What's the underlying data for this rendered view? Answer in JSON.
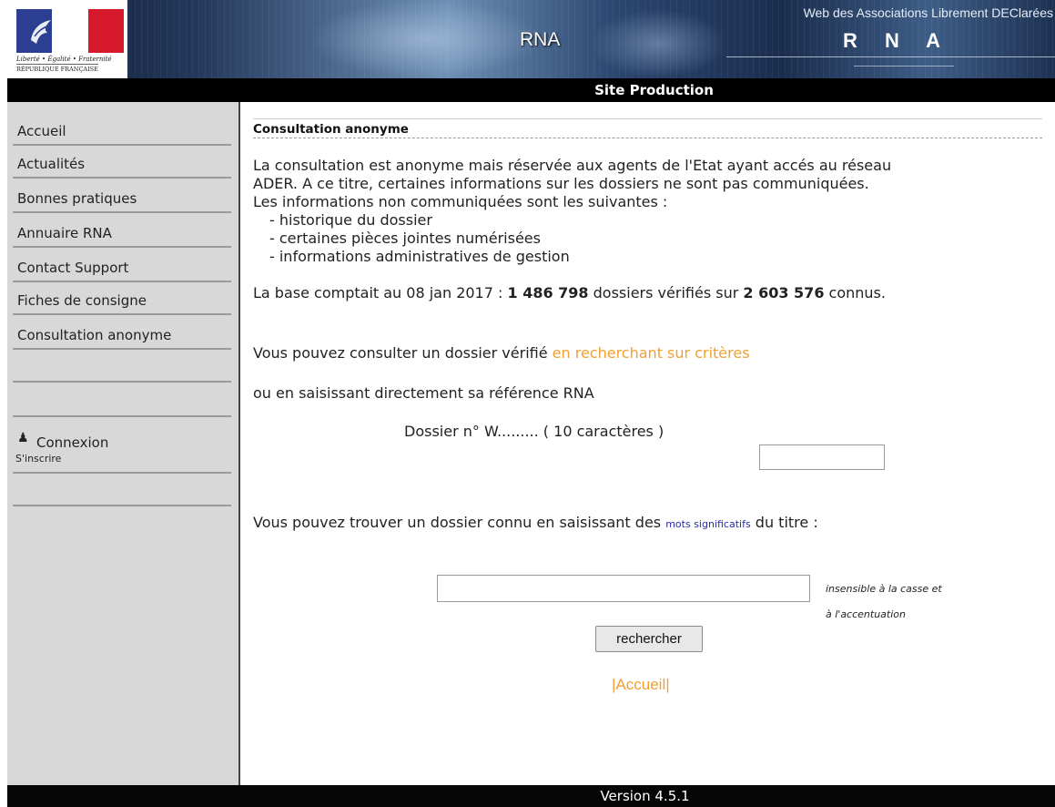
{
  "header": {
    "logo": {
      "devise": "Liberté • Égalité • Fraternité",
      "republique": "RÉPUBLIQUE FRANÇAISE"
    },
    "center_title": "RNA",
    "tagline": "Web des Associations Librement DEClarées",
    "brand": "R N A"
  },
  "site_bar": "Site Production",
  "sidebar": {
    "items": [
      {
        "label": "Accueil"
      },
      {
        "label": "Actualités"
      },
      {
        "label": "Bonnes pratiques"
      },
      {
        "label": "Annuaire RNA"
      },
      {
        "label": "Contact Support"
      },
      {
        "label": "Fiches de consigne"
      },
      {
        "label": "Consultation anonyme"
      }
    ],
    "connexion": "Connexion",
    "inscrire": "S'inscrire"
  },
  "main": {
    "section_title": "Consultation anonyme",
    "intro_lines": [
      "La consultation est anonyme mais réservée aux agents de l'Etat ayant accés au réseau",
      "ADER. A ce titre, certaines informations sur les dossiers ne sont pas communiquées.",
      "Les informations non communiquées sont les suivantes :"
    ],
    "withheld_items": [
      "- historique du dossier",
      "- certaines pièces jointes numérisées",
      "- informations administratives de gestion"
    ],
    "stats": {
      "prefix": "La base comptait au 08 jan 2017 : ",
      "verified": "1 486 798",
      "middle": " dossiers vérifiés sur ",
      "known": "2 603 576",
      "suffix": " connus."
    },
    "criteria": {
      "prefix": "Vous pouvez consulter un dossier vérifié ",
      "link": "en recherchant sur critères"
    },
    "direct_ref": "ou en saisissant directement sa référence RNA",
    "dossier_label": "Dossier n° W......... ( 10 caractères )",
    "dossier_value": "",
    "keyword": {
      "prefix": "Vous pouvez trouver un dossier connu en saisissant des ",
      "link": "mots significatifs",
      "suffix": " du titre :"
    },
    "search_value": "",
    "note_line1": "insensible à la casse et",
    "note_line2": "à l'accentuation",
    "search_button": "rechercher",
    "footer_link": {
      "sep_left": "|",
      "label": "Accueil",
      "sep_right": "|"
    }
  },
  "footer": "Version 4.5.1",
  "colors": {
    "link_orange": "#f0a030",
    "link_blue": "#2b2ba8",
    "sidebar_bg": "#d8d8d8",
    "bar_bg": "#000000"
  }
}
